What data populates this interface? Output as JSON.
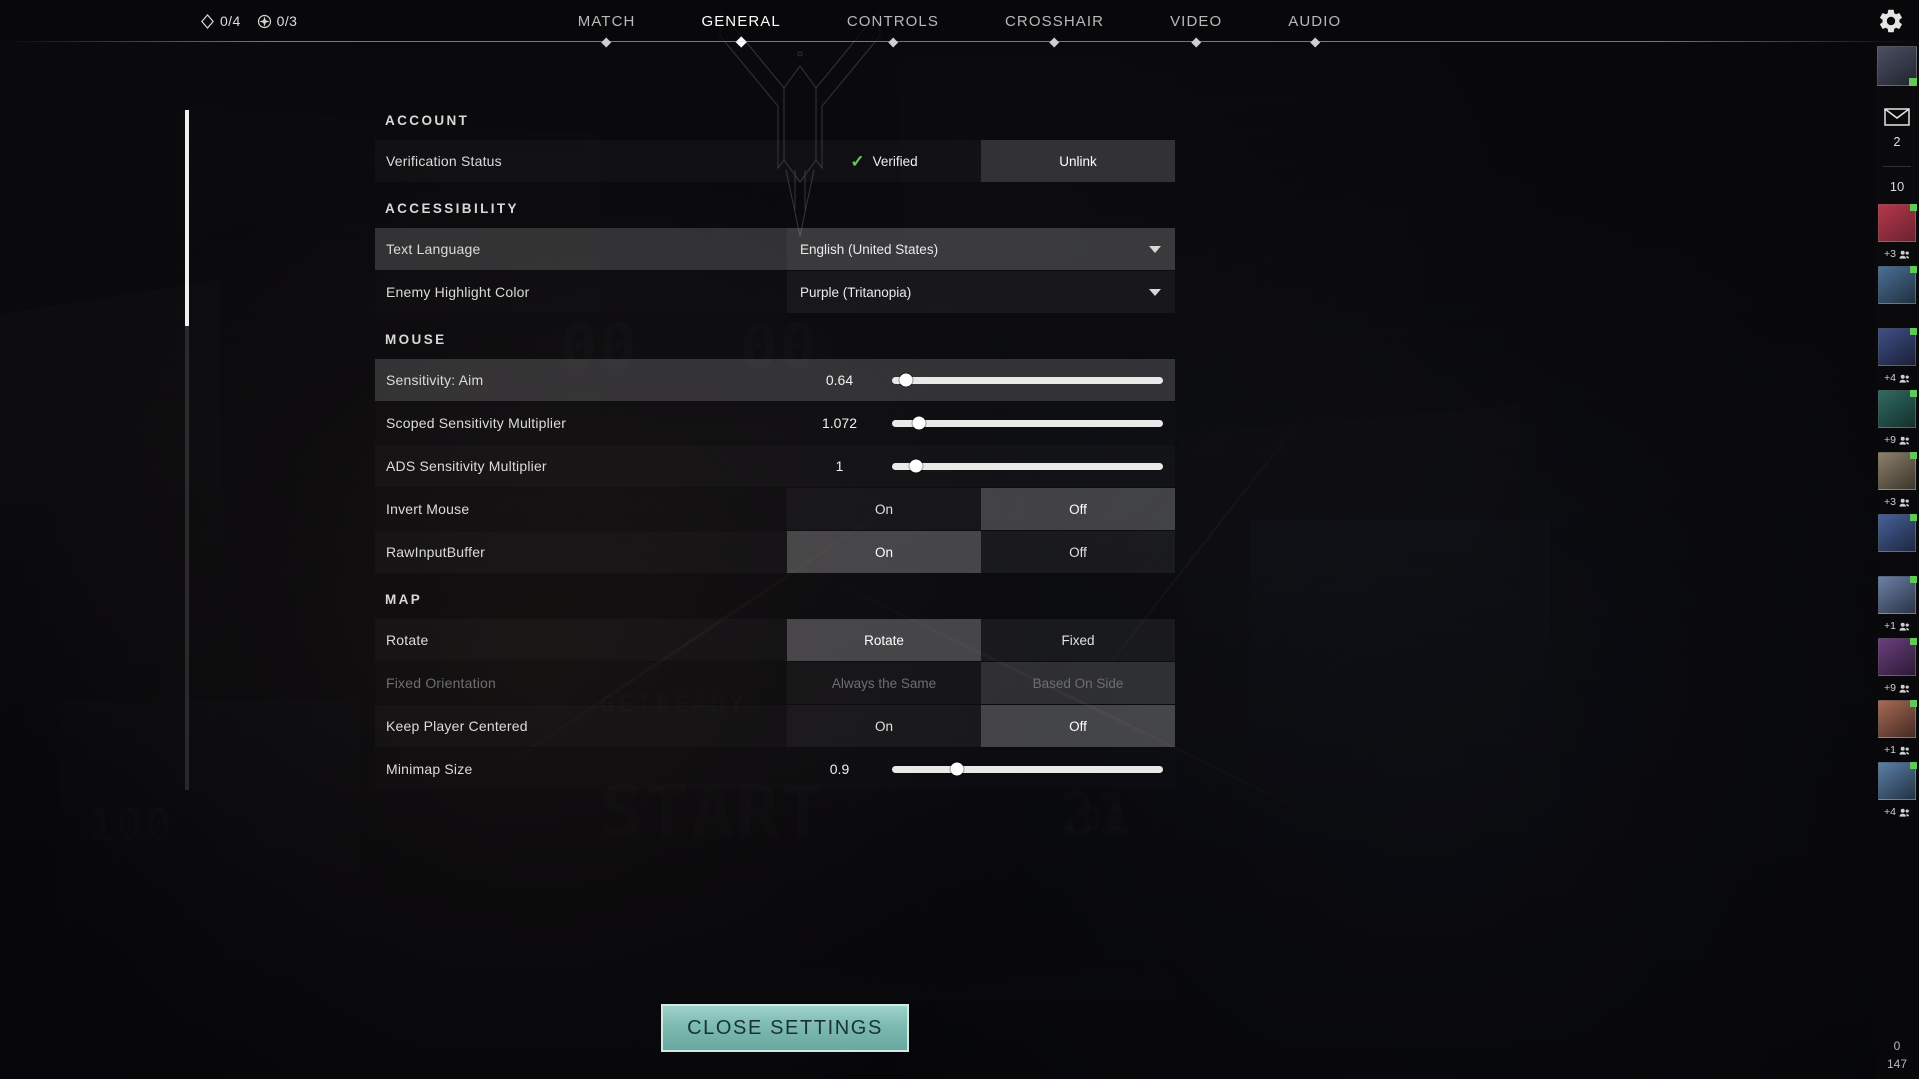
{
  "topbar": {
    "currencies": [
      {
        "icon": "valorant-points-icon",
        "value": "0/4"
      },
      {
        "icon": "radianite-icon",
        "value": "0/3"
      }
    ],
    "tabs": [
      {
        "label": "MATCH",
        "active": false
      },
      {
        "label": "GENERAL",
        "active": true
      },
      {
        "label": "CONTROLS",
        "active": false
      },
      {
        "label": "CROSSHAIR",
        "active": false
      },
      {
        "label": "VIDEO",
        "active": false
      },
      {
        "label": "AUDIO",
        "active": false
      }
    ],
    "settings_icon": "gear-icon"
  },
  "panel": {
    "sections": [
      {
        "heading": "ACCOUNT",
        "rows": [
          {
            "label": "Verification Status",
            "type": "verified",
            "status_text": "Verified",
            "check_icon": "check-icon",
            "action_label": "Unlink",
            "hover": false,
            "disabled": false
          }
        ]
      },
      {
        "heading": "ACCESSIBILITY",
        "rows": [
          {
            "label": "Text Language",
            "type": "dropdown",
            "value": "English (United States)",
            "caret_icon": "chevron-down-icon",
            "hover": true,
            "disabled": false
          },
          {
            "label": "Enemy Highlight Color",
            "type": "dropdown",
            "value": "Purple (Tritanopia)",
            "caret_icon": "chevron-down-icon",
            "hover": false,
            "disabled": false
          }
        ]
      },
      {
        "heading": "MOUSE",
        "rows": [
          {
            "label": "Sensitivity: Aim",
            "type": "slider",
            "value": "0.64",
            "percent": 5,
            "hover": true,
            "disabled": false
          },
          {
            "label": "Scoped Sensitivity Multiplier",
            "type": "slider",
            "value": "1.072",
            "percent": 10,
            "hover": false,
            "disabled": false
          },
          {
            "label": "ADS Sensitivity Multiplier",
            "type": "slider",
            "value": "1",
            "percent": 9,
            "hover": false,
            "disabled": false
          },
          {
            "label": "Invert Mouse",
            "type": "toggle",
            "options": [
              "On",
              "Off"
            ],
            "selected": "Off",
            "hover": false,
            "disabled": false
          },
          {
            "label": "RawInputBuffer",
            "type": "toggle",
            "options": [
              "On",
              "Off"
            ],
            "selected": "On",
            "hover": false,
            "disabled": false
          }
        ]
      },
      {
        "heading": "MAP",
        "rows": [
          {
            "label": "Rotate",
            "type": "toggle",
            "options": [
              "Rotate",
              "Fixed"
            ],
            "selected": "Rotate",
            "hover": false,
            "disabled": false
          },
          {
            "label": "Fixed Orientation",
            "type": "toggle",
            "options": [
              "Always the Same",
              "Based On Side"
            ],
            "selected": "Based On Side",
            "hover": false,
            "disabled": true
          },
          {
            "label": "Keep Player Centered",
            "type": "toggle",
            "options": [
              "On",
              "Off"
            ],
            "selected": "Off",
            "hover": false,
            "disabled": false
          },
          {
            "label": "Minimap Size",
            "type": "slider",
            "value": "0.9",
            "percent": 24,
            "hover": false,
            "disabled": false
          }
        ]
      }
    ]
  },
  "footer": {
    "close_label": "CLOSE SETTINGS"
  },
  "social": {
    "mail_icon": "mail-icon",
    "mail_count": "2",
    "online_count": "10",
    "friends": [
      {
        "badge": "+3",
        "status_color": "#63c85a",
        "tint_a": "#b4384a",
        "tint_b": "#6c2230"
      },
      {
        "badge": "",
        "status_color": "#63c85a",
        "tint_a": "#4a6f96",
        "tint_b": "#21303f"
      },
      {
        "badge": "+4",
        "status_color": "#63c85a",
        "tint_a": "#3f4e86",
        "tint_b": "#1b2038"
      },
      {
        "badge": "+9",
        "status_color": "#63c85a",
        "tint_a": "#2f6a62",
        "tint_b": "#15302c"
      },
      {
        "badge": "+3",
        "status_color": "#63c85a",
        "tint_a": "#8d7f6b",
        "tint_b": "#3b352c"
      },
      {
        "badge": "",
        "status_color": "#63c85a",
        "tint_a": "#46619a",
        "tint_b": "#1d2740"
      },
      {
        "badge": "+1",
        "status_color": "#63c85a",
        "tint_a": "#6b7fa6",
        "tint_b": "#2b3446"
      },
      {
        "badge": "+9",
        "status_color": "#63c85a",
        "tint_a": "#6a3f7e",
        "tint_b": "#2c1a35"
      },
      {
        "badge": "+1",
        "status_color": "#63c85a",
        "tint_a": "#a66a55",
        "tint_b": "#452a22"
      },
      {
        "badge": "+4",
        "status_color": "#63c85a",
        "tint_a": "#5b7fa8",
        "tint_b": "#233244"
      }
    ],
    "tail_numbers": [
      "0",
      "147"
    ]
  },
  "colors": {
    "accent_teal": "#7ab8b0",
    "verified_green": "#63c85a",
    "panel_row": "rgba(255,255,255,0.028)",
    "row_hover": "rgba(255,255,255,0.16)"
  }
}
